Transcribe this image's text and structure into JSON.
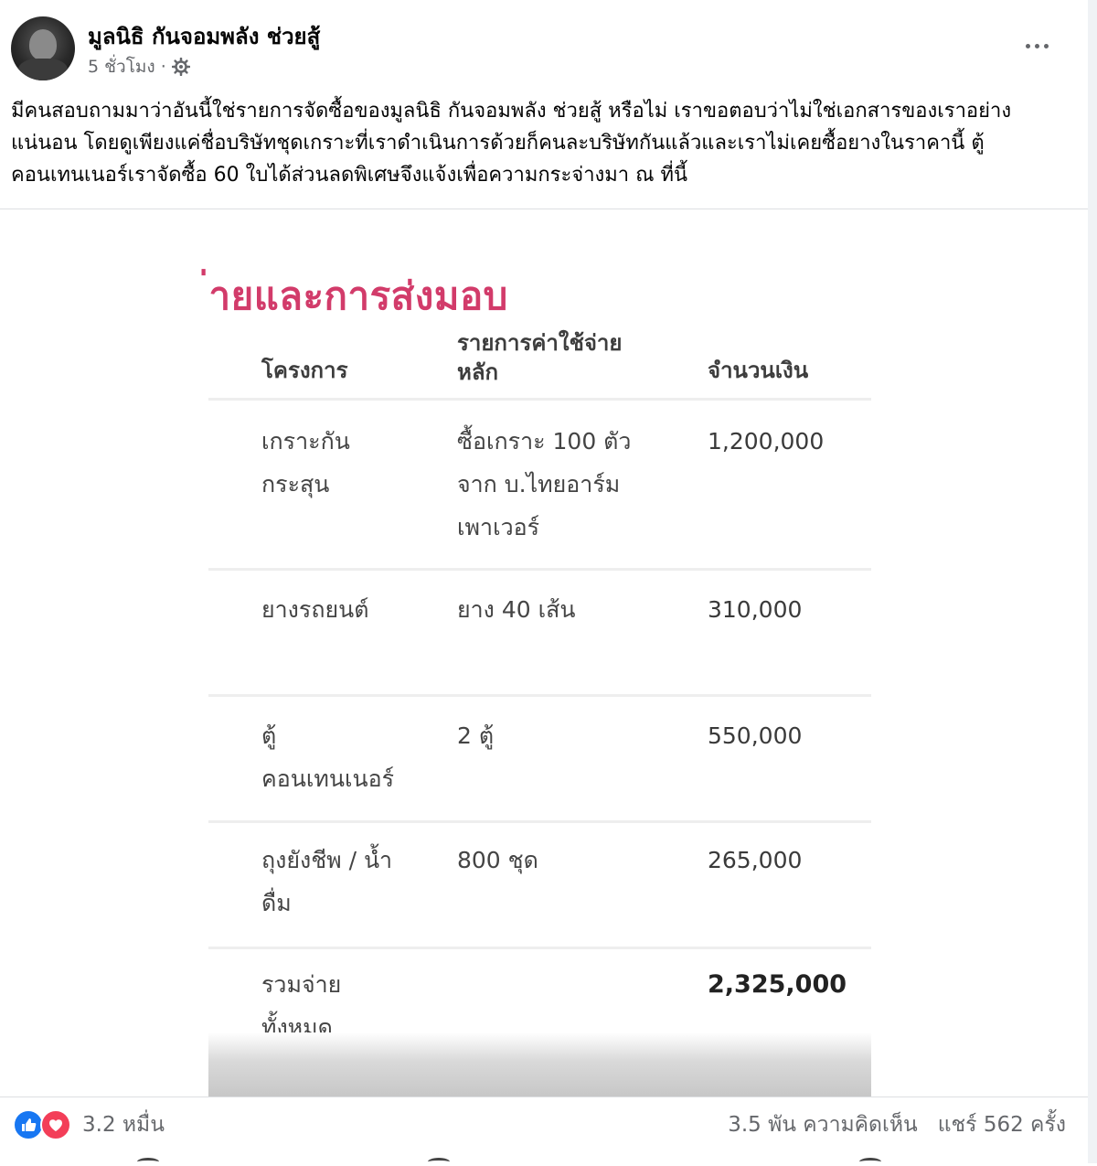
{
  "post": {
    "author": "มูลนิธิ กันจอมพลัง ช่วยสู้",
    "timestamp": "5 ชั่วโมง",
    "separator": "·",
    "privacy_icon": "gear-icon",
    "text": "มีคนสอบถามมาว่าอันนี้ใช่รายการจัดซื้อของมูลนิธิ กันจอมพลัง ช่วยสู้ หรือไม่ เราขอตอบว่าไม่ใช่เอกสารของเราอย่างแน่นอน โดยดูเพียงแค่ชื่อบริษัทชุดเกราะที่เราดำเนินการด้วยก็คนละบริษัทกันแล้วและเราไม่เคยซื้อยางในราคานี้ ตู้คอนเทนเนอร์เราจัดซื้อ 60 ใบได้ส่วนลดพิเศษจึงแจ้งเพื่อความกระจ่างมา ณ ที่นี้"
  },
  "document": {
    "heading": "่ายและการส่งมอบ",
    "accent_color": "#d23b6a",
    "headers": {
      "project": "โครงการ",
      "expense_line1": "รายการค่าใช้จ่าย",
      "expense_line2": "หลัก",
      "amount": "จำนวนเงิน"
    },
    "rows": [
      {
        "project_line1": "เกราะกัน",
        "project_line2": "กระสุน",
        "expense_line1": "ซื้อเกราะ 100 ตัว",
        "expense_line2": "จาก บ.ไทยอาร์ม",
        "expense_line3": "เพาเวอร์",
        "amount": "1,200,000"
      },
      {
        "project_line1": "ยางรถยนต์",
        "expense_line1": "ยาง 40 เส้น",
        "amount": "310,000"
      },
      {
        "project_line1": "ตู้",
        "project_line2": "คอนเทนเนอร์",
        "expense_line1": "2 ตู้",
        "amount": "550,000"
      },
      {
        "project_line1": "ถุงยังชีพ / น้ำ",
        "project_line2": "ดื่ม",
        "expense_line1": "800 ชุด",
        "amount": "265,000"
      }
    ],
    "total": {
      "label_line1": "รวมจ่าย",
      "label_line2": "ทั้งหมด",
      "amount": "2,325,000"
    }
  },
  "footer": {
    "reaction_count": "3.2 หมื่น",
    "comments": "3.5 พัน ความคิดเห็น",
    "shares": "แชร์ 562 ครั้ง",
    "like_color": "#1877f2",
    "love_color": "#f33e58"
  }
}
